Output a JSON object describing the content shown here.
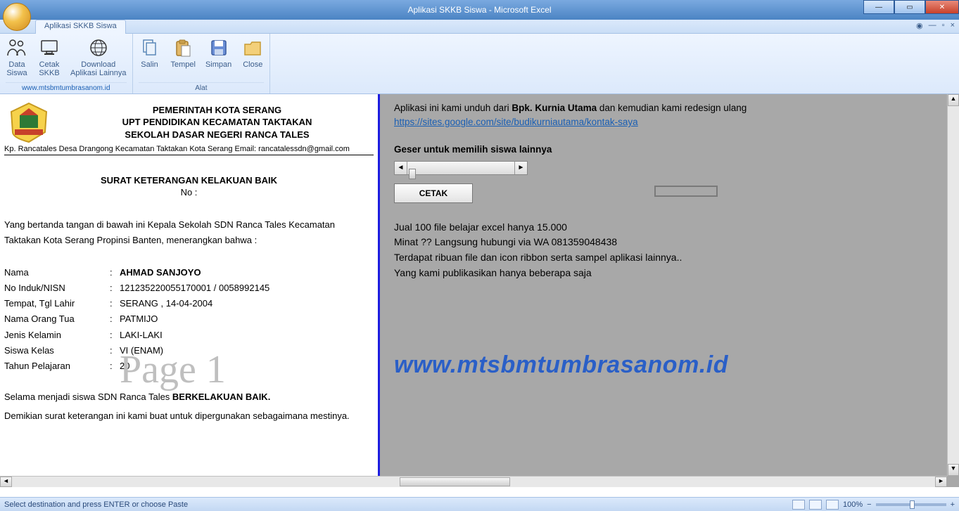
{
  "window": {
    "title": "Aplikasi SKKB Siswa - Microsoft Excel"
  },
  "tab": {
    "label": "Aplikasi SKKB Siswa"
  },
  "ribbon": {
    "group1": {
      "data_siswa": "Data\nSiswa",
      "cetak_skkb": "Cetak\nSKKB",
      "download": "Download\nAplikasi Lainnya",
      "label": "www.mtsbmtumbrasanom.id"
    },
    "group2": {
      "salin": "Salin",
      "tempel": "Tempel",
      "simpan": "Simpan",
      "close": "Close",
      "label": "Alat"
    }
  },
  "doc": {
    "hdr1": "PEMERINTAH KOTA SERANG",
    "hdr2": "UPT PENDIDIKAN KECAMATAN TAKTAKAN",
    "hdr3": "SEKOLAH DASAR NEGERI RANCA TALES",
    "address": "Kp. Rancatales Desa Drangong Kecamatan Taktakan Kota Serang Email: rancatalessdn@gmail.com",
    "subtitle": "SURAT KETERANGAN KELAKUAN BAIK",
    "no": "No :",
    "para1": "Yang bertanda tangan di bawah ini Kepala Sekolah SDN Ranca Tales Kecamatan Taktakan Kota Serang Propinsi Banten, menerangkan bahwa :",
    "fields": {
      "nama_l": "Nama",
      "nama_v": "AHMAD SANJOYO",
      "nisn_l": "No Induk/NISN",
      "nisn_v": "121235220055170001 / 0058992145",
      "ttl_l": "Tempat, Tgl Lahir",
      "ttl_v": "SERANG , 14-04-2004",
      "ortu_l": "Nama Orang Tua",
      "ortu_v": "PATMIJO",
      "jk_l": "Jenis Kelamin",
      "jk_v": "LAKI-LAKI",
      "kelas_l": "Siswa Kelas",
      "kelas_v": "VI (ENAM)",
      "tp_l": "Tahun Pelajaran",
      "tp_v": "20"
    },
    "para2a": "Selama menjadi siswa SDN Ranca Tales ",
    "para2b": "BERKELAKUAN BAIK.",
    "para3": "Demikian surat keterangan ini kami buat untuk dipergunakan sebagaimana mestinya.",
    "watermark": "Page 1"
  },
  "right": {
    "line1a": "Aplikasi ini kami unduh dari ",
    "line1b": "Bpk. Kurnia Utama",
    "line1c": " dan kemudian kami redesign ulang",
    "link": "https://sites.google.com/site/budikurniautama/kontak-saya",
    "heading": "Geser untuk memilih siswa lainnya",
    "cetak": "CETAK",
    "promo1": "Jual 100 file belajar excel hanya 15.000",
    "promo2": "Minat ?? Langsung hubungi via WA 081359048438",
    "promo3": "Terdapat ribuan file dan icon ribbon serta sampel aplikasi lainnya..",
    "promo4": "Yang kami publikasikan hanya beberapa saja",
    "bigurl": "www.mtsbmtumbrasanom.id"
  },
  "status": {
    "msg": "Select destination and press ENTER or choose Paste",
    "zoom": "100%"
  }
}
